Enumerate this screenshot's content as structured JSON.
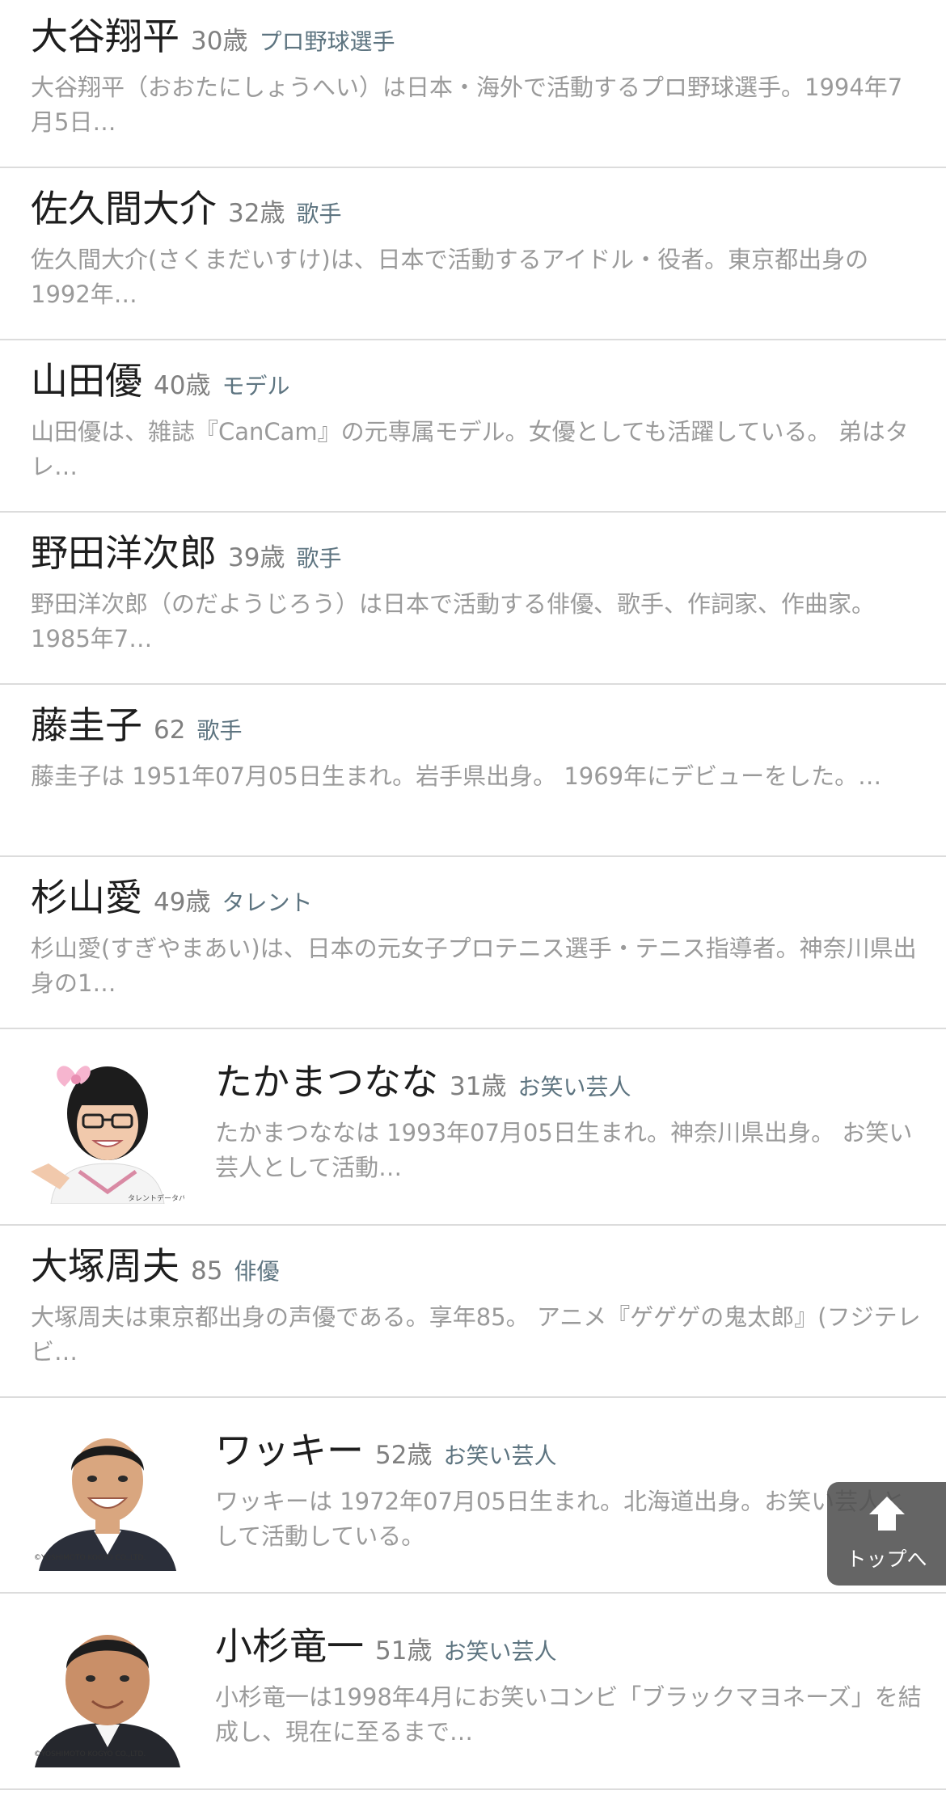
{
  "people": [
    {
      "name": "大谷翔平",
      "age": "30歳",
      "job": "プロ野球選手",
      "desc": "大谷翔平（おおたにしょうへい）は日本・海外で活動するプロ野球選手。1994年7月5日…"
    },
    {
      "name": "佐久間大介",
      "age": "32歳",
      "job": "歌手",
      "desc": "佐久間大介(さくまだいすけ)は、日本で活動するアイドル・役者。東京都出身の1992年…"
    },
    {
      "name": "山田優",
      "age": "40歳",
      "job": "モデル",
      "desc": "山田優は、雑誌『CanCam』の元専属モデル。女優としても活躍している。 弟はタレ…"
    },
    {
      "name": "野田洋次郎",
      "age": "39歳",
      "job": "歌手",
      "desc": "野田洋次郎（のだようじろう）は日本で活動する俳優、歌手、作詞家、作曲家。1985年7…"
    },
    {
      "name": "藤圭子",
      "age": "62",
      "job": "歌手",
      "desc": "藤圭子は 1951年07月05日生まれ。岩手県出身。 1969年にデビューをした。…"
    },
    {
      "name": "杉山愛",
      "age": "49歳",
      "job": "タレント",
      "desc": "杉山愛(すぎやまあい)は、日本の元女子プロテニス選手・テニス指導者。神奈川県出身の1…"
    },
    {
      "name": "たかまつなな",
      "age": "31歳",
      "job": "お笑い芸人",
      "desc": "たかまつななは 1993年07月05日生まれ。神奈川県出身。 お笑い芸人として活動…",
      "photo": "photo-takamatsu",
      "photo_caption": "タレントデータバンク"
    },
    {
      "name": "大塚周夫",
      "age": "85",
      "job": "俳優",
      "desc": "大塚周夫は東京都出身の声優である。享年85。 アニメ『ゲゲゲの鬼太郎』(フジテレビ…"
    },
    {
      "name": "ワッキー",
      "age": "52歳",
      "job": "お笑い芸人",
      "desc": "ワッキーは 1972年07月05日生まれ。北海道出身。お笑い芸人として活動している。",
      "photo": "photo-wakki",
      "photo_caption": "©YOSHIMOTO KOGYO CO.,LTD."
    },
    {
      "name": "小杉竜一",
      "age": "51歳",
      "job": "お笑い芸人",
      "desc": "小杉竜一は1998年4月にお笑いコンビ「ブラックマヨネーズ」を結成し、現在に至るまで…",
      "photo": "photo-kosugi",
      "photo_caption": "©YOSHIMOTO KOGYO CO.,LTD."
    }
  ],
  "scroll_top": {
    "label": "トップへ",
    "icon": "arrow-up-icon"
  },
  "colors": {
    "name": "#1e1e1e",
    "age": "#808080",
    "job": "#5d7480",
    "desc": "#9a9a9a",
    "divider": "#dcdcdc",
    "button_bg": "#505050"
  }
}
